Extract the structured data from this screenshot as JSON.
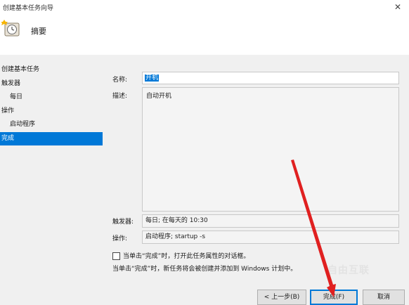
{
  "window": {
    "title": "创建基本任务向导",
    "close_glyph": "✕"
  },
  "header": {
    "heading": "摘要"
  },
  "nav": {
    "items": [
      {
        "label": "创建基本任务"
      },
      {
        "label": "触发器"
      },
      {
        "label": "每日"
      },
      {
        "label": "操作"
      },
      {
        "label": "启动程序"
      },
      {
        "label": "完成"
      }
    ],
    "active_index": 5
  },
  "form": {
    "name_label": "名称:",
    "name_value": "开机",
    "desc_label": "描述:",
    "desc_value": "自动开机",
    "trigger_label": "触发器:",
    "trigger_value": "每日; 在每天的 10:30",
    "action_label": "操作:",
    "action_value": "启动程序; startup -s"
  },
  "checkbox": {
    "label": "当单击“完成”时，打开此任务属性的对话框。",
    "checked": false
  },
  "note": "当单击“完成”时，新任务将会被创建并添加到 Windows 计划中。",
  "buttons": {
    "back": "< 上一步(B)",
    "finish": "完成(F)",
    "cancel": "取消"
  },
  "watermark": "自由互联",
  "colors": {
    "accent": "#0078d7",
    "annotation_arrow": "#e02020"
  },
  "icons": {
    "wizard": "task-scheduler-clock-icon",
    "close": "close-icon"
  }
}
